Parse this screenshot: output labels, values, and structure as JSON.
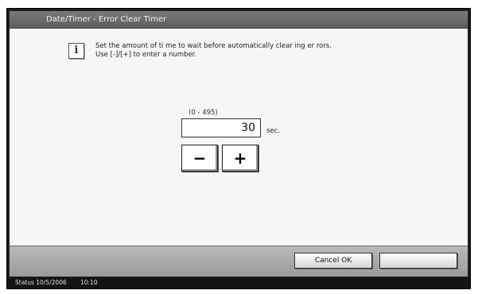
{
  "window": {
    "title": "Date/Timer - Error Clear Timer"
  },
  "message": {
    "line1": "Set the amount of ti me to wait before automatically clear ing er rors.",
    "line2": "Use [-]/[+] to enter a number."
  },
  "timer": {
    "range": "(0 - 495)",
    "value": "30",
    "unit": "sec."
  },
  "stepper": {
    "minus": "−",
    "plus": "+"
  },
  "footer": {
    "cancel_ok": "Cancel OK",
    "blank": ""
  },
  "status": {
    "label": "Status 10/5/2006",
    "time": "10:10"
  },
  "icons": {
    "info": "i"
  },
  "colors": {
    "titlebar": "#6b6b6b",
    "statusbar": "#141414",
    "content": "#f6f6f6"
  }
}
